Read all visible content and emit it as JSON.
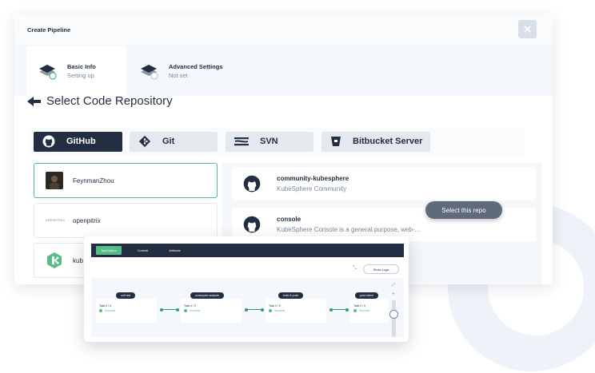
{
  "modal": {
    "title": "Create Pipeline",
    "close_symbol": "✕"
  },
  "steps": [
    {
      "label": "Basic Info",
      "sub": "Setting up",
      "icon": "layers-icon"
    },
    {
      "label": "Advanced Settings",
      "sub": "Not set",
      "icon": "layers-icon"
    }
  ],
  "section": {
    "title": "Select Code Repository",
    "back_icon": "back-arrow-icon"
  },
  "repo_tabs": [
    {
      "label": "GitHub",
      "icon": "github-icon",
      "active": true
    },
    {
      "label": "Git",
      "icon": "git-icon",
      "active": false
    },
    {
      "label": "SVN",
      "icon": "svn-icon",
      "active": false
    },
    {
      "label": "Bitbucket Server",
      "icon": "bitbucket-icon",
      "active": false
    }
  ],
  "orgs": [
    {
      "name": "FeynmanZhou",
      "selected": true
    },
    {
      "name": "openpitrix",
      "logo_text": "OPENPITRIX"
    },
    {
      "name": "kub"
    }
  ],
  "repos": [
    {
      "name": "community-kubesphere",
      "desc": "KubeSphere Community"
    },
    {
      "name": "console",
      "desc": "KubeSphere Console is a general purpose, web-..."
    }
  ],
  "select_button": "Select this repo",
  "overlay": {
    "tabs": [
      "TaskStatus",
      "Commit",
      "Artifacts"
    ],
    "show_logs": "Show Logs",
    "stages": [
      {
        "pill": "unit test",
        "task": "Task 0 / 0",
        "status": "Success"
      },
      {
        "pill": "sonarqube analysis",
        "task": "Task 0 / 0",
        "status": "Success"
      },
      {
        "pill": "build & push",
        "task": "Task 0 / 0",
        "status": "Success"
      },
      {
        "pill": "push latest",
        "task": "Task 0 / 0",
        "status": "Success"
      }
    ]
  },
  "colors": {
    "accent": "#55bc8a",
    "dark": "#242e42",
    "muted": "#79879c"
  }
}
